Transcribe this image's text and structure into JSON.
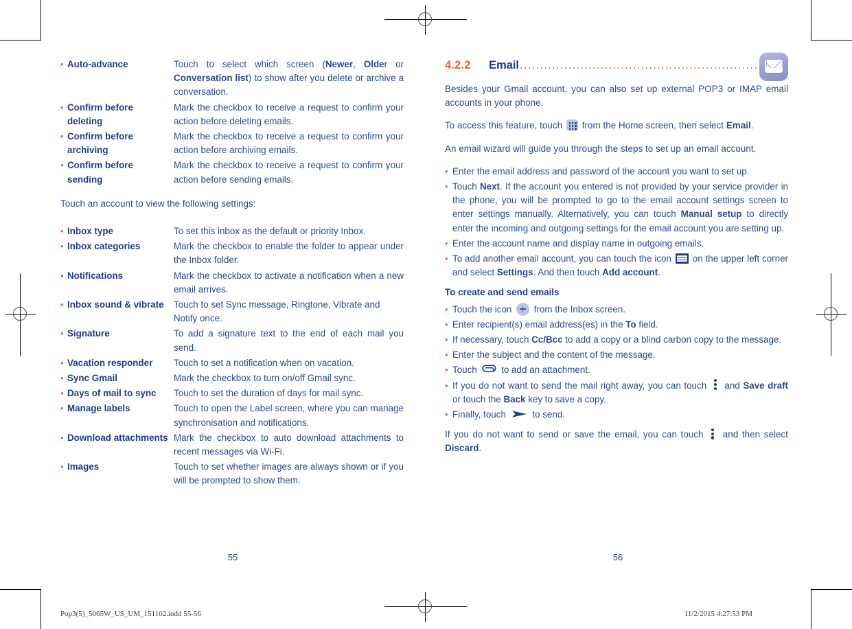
{
  "document": {
    "left_page_number": "55",
    "right_page_number": "56",
    "footer_left": "Pop3(5)_5065W_US_UM_151102.indd   55-56",
    "footer_right": "11/2/2015   4:27:53 PM"
  },
  "colors": {
    "accent_orange": "#e8622b",
    "heading_blue": "#1f3d87",
    "body_blue": "#2b4a8b",
    "icon_lavender": "#c3c3e4"
  },
  "left_page": {
    "settings_table_top": [
      {
        "term": "Auto-advance",
        "desc_parts": [
          {
            "t": "Touch to select which screen (",
            "b": false
          },
          {
            "t": "Newer",
            "b": true
          },
          {
            "t": ", ",
            "b": false
          },
          {
            "t": "Olde",
            "b": true
          },
          {
            "t": "r or ",
            "b": false
          },
          {
            "t": "Conversation list",
            "b": true
          },
          {
            "t": ") to show after you delete or archive a conversation.",
            "b": false
          }
        ]
      },
      {
        "term": "Confirm before deleting",
        "desc_parts": [
          {
            "t": "Mark the checkbox to receive a request to confirm your action before deleting emails.",
            "b": false
          }
        ]
      },
      {
        "term": "Confirm before archiving",
        "desc_parts": [
          {
            "t": "Mark the checkbox to receive a request to confirm your action before archiving emails.",
            "b": false
          }
        ]
      },
      {
        "term": "Confirm before sending",
        "desc_parts": [
          {
            "t": "Mark the checkbox to receive a request to confirm your action before sending emails.",
            "b": false
          }
        ]
      }
    ],
    "intro_line": "Touch an account to view the following settings:",
    "settings_table_bottom": [
      {
        "term": "Inbox type",
        "justify": false,
        "desc_parts": [
          {
            "t": "To set this inbox as the default or priority Inbox.",
            "b": false
          }
        ]
      },
      {
        "term": "Inbox categories",
        "justify": true,
        "desc_parts": [
          {
            "t": "Mark the checkbox to enable the folder to appear under the Inbox folder.",
            "b": false
          }
        ]
      },
      {
        "term": "Notifications",
        "justify": true,
        "desc_parts": [
          {
            "t": "Mark the checkbox to activate a notification when a new email arrives.",
            "b": false
          }
        ]
      },
      {
        "term": "Inbox sound & vibrate",
        "justify": false,
        "desc_parts": [
          {
            "t": "Touch to set Sync message, Ringtone, Vibrate and Notify once.",
            "b": false
          }
        ]
      },
      {
        "term": "Signature",
        "justify": true,
        "desc_parts": [
          {
            "t": "To add a signature text to the end of each mail you send.",
            "b": false
          }
        ]
      },
      {
        "term": "Vacation responder",
        "justify": false,
        "desc_parts": [
          {
            "t": "Touch to set a notification when on vacation.",
            "b": false
          }
        ]
      },
      {
        "term": "Sync Gmail",
        "justify": false,
        "desc_parts": [
          {
            "t": "Mark the checkbox to turn on/off Gmail sync.",
            "b": false
          }
        ]
      },
      {
        "term": "Days of mail to sync",
        "justify": false,
        "desc_parts": [
          {
            "t": "Touch to set the duration of days for mail sync.",
            "b": false
          }
        ]
      },
      {
        "term": "Manage labels",
        "justify": true,
        "desc_parts": [
          {
            "t": "Touch to open the Label screen, where you can manage synchronisation and notifications.",
            "b": false
          }
        ]
      },
      {
        "term": "Download attachments",
        "justify": true,
        "desc_parts": [
          {
            "t": "Mark the checkbox to auto download attachments to recent messages via Wi-Fi.",
            "b": false
          }
        ]
      },
      {
        "term": "Images",
        "justify": true,
        "desc_parts": [
          {
            "t": "Touch to set whether images are always shown or if you will be prompted to show them.",
            "b": false
          }
        ]
      }
    ]
  },
  "right_page": {
    "section": {
      "number": "4.2.2",
      "title": "Email",
      "leaders": "..................................................................",
      "icon": "envelope-icon"
    },
    "intro_paragraph": "Besides your Gmail account, you can also set up external POP3 or IMAP email accounts in your phone.",
    "access_paragraph": [
      {
        "t": "To access this feature, touch ",
        "b": false
      },
      {
        "icon": "apps-grid-icon"
      },
      {
        "t": " from the Home screen, then select ",
        "b": false
      },
      {
        "t": "Email",
        "b": true
      },
      {
        "t": ".",
        "b": false
      }
    ],
    "wizard_paragraph": "An email wizard will guide you through the steps to set up an email account.",
    "setup_steps": [
      {
        "justify": false,
        "parts": [
          {
            "t": "Enter the email address and password of the account you want to set up.",
            "b": false
          }
        ]
      },
      {
        "justify": true,
        "parts": [
          {
            "t": "Touch ",
            "b": false
          },
          {
            "t": "Next",
            "b": true
          },
          {
            "t": ". If the account you entered is not provided by your service provider in the phone, you will be prompted to go to the email account settings screen to enter settings manually. Alternatively, you can touch ",
            "b": false
          },
          {
            "t": "Manual setup",
            "b": true
          },
          {
            "t": " to directly enter the incoming and outgoing settings for the email account you are setting up.",
            "b": false
          }
        ]
      },
      {
        "justify": false,
        "parts": [
          {
            "t": "Enter the account name and display name in outgoing emails.",
            "b": false
          }
        ]
      },
      {
        "justify": true,
        "parts": [
          {
            "t": "To add another email account, you can touch the icon ",
            "b": false
          },
          {
            "icon": "list-lines-icon"
          },
          {
            "t": " on the upper left corner and select ",
            "b": false
          },
          {
            "t": "Settings",
            "b": true
          },
          {
            "t": ". And then touch ",
            "b": false
          },
          {
            "t": "Add account",
            "b": true
          },
          {
            "t": ".",
            "b": false
          }
        ]
      }
    ],
    "create_heading": "To create and send emails",
    "create_steps": [
      {
        "justify": false,
        "parts": [
          {
            "t": "Touch the icon ",
            "b": false
          },
          {
            "icon": "plus-circle-icon"
          },
          {
            "t": " from the Inbox screen.",
            "b": false
          }
        ]
      },
      {
        "justify": false,
        "parts": [
          {
            "t": "Enter recipient(s) email address(es) in the ",
            "b": false
          },
          {
            "t": "To",
            "b": true
          },
          {
            "t": " field.",
            "b": false
          }
        ]
      },
      {
        "justify": true,
        "parts": [
          {
            "t": "If necessary, touch ",
            "b": false
          },
          {
            "t": "Cc/Bcc",
            "b": true
          },
          {
            "t": " to add a copy or a blind carbon copy to the message.",
            "b": false
          }
        ]
      },
      {
        "justify": false,
        "parts": [
          {
            "t": "Enter the subject and the content of the message.",
            "b": false
          }
        ]
      },
      {
        "justify": false,
        "parts": [
          {
            "t": "Touch ",
            "b": false
          },
          {
            "icon": "paperclip-icon"
          },
          {
            "t": " to add an attachment.",
            "b": false
          }
        ]
      },
      {
        "justify": true,
        "parts": [
          {
            "t": "If you do not want to send the mail right away, you can touch ",
            "b": false
          },
          {
            "icon": "overflow-dots-icon"
          },
          {
            "t": " and ",
            "b": false
          },
          {
            "t": "Save draft",
            "b": true
          },
          {
            "t": " or touch the ",
            "b": false
          },
          {
            "t": "Back",
            "b": true
          },
          {
            "t": " key to save a copy.",
            "b": false
          }
        ]
      },
      {
        "justify": false,
        "parts": [
          {
            "t": "Finally, touch ",
            "b": false
          },
          {
            "icon": "send-arrow-icon"
          },
          {
            "t": " to send.",
            "b": false
          }
        ]
      }
    ],
    "discard_paragraph": [
      {
        "t": "If you do not want to send or save the email, you can touch ",
        "b": false
      },
      {
        "icon": "overflow-dots-icon"
      },
      {
        "t": " and then select ",
        "b": false
      },
      {
        "t": "Discard",
        "b": true
      },
      {
        "t": ".",
        "b": false
      }
    ]
  }
}
